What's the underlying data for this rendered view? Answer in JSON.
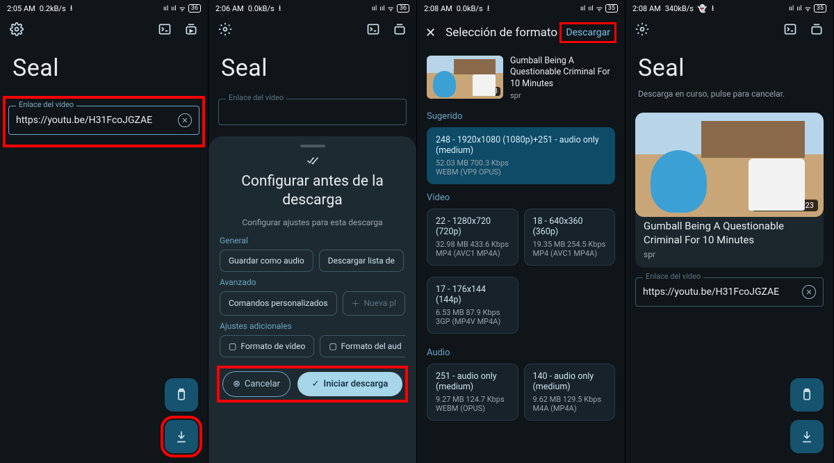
{
  "panels": {
    "p1": {
      "status": {
        "time": "2:05 AM",
        "net": "0.2kB/s",
        "batt": "36"
      },
      "app_title": "Seal",
      "field": {
        "label": "Enlace del vídeo",
        "value": "https://youtu.be/H31FcoJGZAE"
      }
    },
    "p2": {
      "status": {
        "time": "2:06 AM",
        "net": "0.0kB/s",
        "batt": "36"
      },
      "app_title": "Seal",
      "field": {
        "label": "Enlace del vídeo"
      },
      "sheet": {
        "title": "Configurar antes de la descarga",
        "subtitle": "Configurar ajustes para esta descarga",
        "sec_general": "General",
        "chip_audio": "Guardar como audio",
        "chip_playlist": "Descargar lista de",
        "sec_advanced": "Avanzado",
        "chip_custom": "Comandos personalizados",
        "chip_new_tpl": "Nueva pl",
        "sec_additional": "Ajustes adicionales",
        "chip_vfmt": "Formato de vídeo",
        "chip_afmt": "Formato del aud",
        "btn_cancel": "Cancelar",
        "btn_start": "Iniciar descarga"
      }
    },
    "p3": {
      "status": {
        "time": "2:08 AM",
        "net": "0.0kB/s",
        "batt": "35"
      },
      "topbar_title": "Selección de formato",
      "download_btn": "Descargar",
      "video": {
        "title": "Gumball Being A Questionable Criminal For 10 Minutes",
        "channel": "spr",
        "duration": "10:23"
      },
      "sec_suggested": "Sugerido",
      "suggested": {
        "line1": "248 - 1920x1080 (1080p)+251 - audio only (medium)",
        "line2": "52.03 MB 700.3 Kbps",
        "line3": "WEBM (VP9 OPUS)"
      },
      "sec_video": "Vídeo",
      "vids": [
        {
          "l1": "22 - 1280x720 (720p)",
          "l2": "32.98 MB 433.6 Kbps",
          "l3": "MP4 (AVC1 MP4A)"
        },
        {
          "l1": "18 - 640x360 (360p)",
          "l2": "19.35 MB 254.5 Kbps",
          "l3": "MP4 (AVC1 MP4A)"
        },
        {
          "l1": "17 - 176x144 (144p)",
          "l2": "6.53 MB 87.9 Kbps",
          "l3": "3GP (MP4V MP4A)"
        }
      ],
      "sec_audio": "Audio",
      "auds": [
        {
          "l1": "251 - audio only (medium)",
          "l2": "9.27 MB 124.7 Kbps",
          "l3": "WEBM (OPUS)"
        },
        {
          "l1": "140 - audio only (medium)",
          "l2": "9.62 MB 129.5 Kbps",
          "l3": "M4A (MP4A)"
        }
      ]
    },
    "p4": {
      "status": {
        "time": "2:08 AM",
        "net": "340kB/s",
        "batt": "35"
      },
      "app_title": "Seal",
      "sub_msg": "Descarga en curso, pulse para cancelar.",
      "thumb_badge": "52.03 MB · 10:23",
      "dl_title": "Gumball Being A Questionable Criminal For 10 Minutes",
      "dl_channel": "spr",
      "field": {
        "label": "Enlace del vídeo",
        "value": "https://youtu.be/H31FcoJGZAE"
      }
    }
  }
}
